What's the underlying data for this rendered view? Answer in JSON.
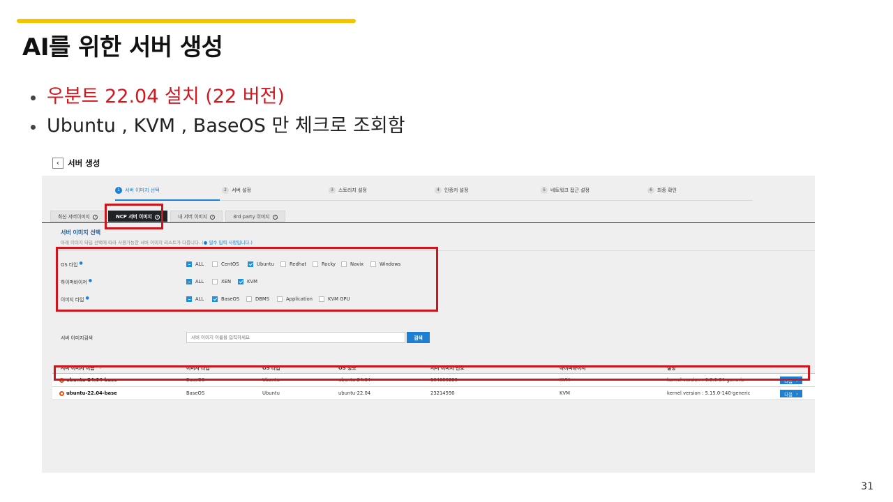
{
  "slide": {
    "title": "AI를 위한 서버 생성",
    "bullets": [
      "우분트 22.04 설치 (22 버전)",
      "Ubuntu , KVM , BaseOS 만 체크로 조회함"
    ],
    "page_number": "31",
    "accent_color": "#f6c300",
    "highlight_color": "#d4161e"
  },
  "console": {
    "title": "서버 생성",
    "back_icon": "chevron-left-icon",
    "steps": [
      {
        "num": "1",
        "label": "서버 이미지 선택",
        "active": true
      },
      {
        "num": "2",
        "label": "서버 설정"
      },
      {
        "num": "3",
        "label": "스토리지 설정"
      },
      {
        "num": "4",
        "label": "인증키 설정"
      },
      {
        "num": "5",
        "label": "네트워크 접근 설정"
      },
      {
        "num": "6",
        "label": "최종 확인"
      }
    ],
    "tabs": [
      {
        "label": "최신 서버이미지",
        "active": false
      },
      {
        "label": "NCP 서버 이미지",
        "active": true
      },
      {
        "label": "내 서버 이미지",
        "active": false
      },
      {
        "label": "3rd party 이미지",
        "active": false
      }
    ],
    "section_title": "서버 이미지 선택",
    "section_desc": "아래 이미지 타입 선택에 따라 사용가능한 서버 이미지 리스트가 다릅니다. (",
    "section_desc_req": "● 필수 입력 사항입니다.)",
    "filters": {
      "os": {
        "label": "OS 타입",
        "options": [
          "ALL",
          "CentOS",
          "Ubuntu",
          "Redhat",
          "Rocky",
          "Navix",
          "Windows"
        ],
        "checked": [
          false,
          false,
          true,
          false,
          false,
          false,
          false
        ]
      },
      "hypervisor": {
        "label": "하이퍼바이저",
        "options": [
          "ALL",
          "XEN",
          "KVM"
        ],
        "checked": [
          false,
          false,
          true
        ]
      },
      "image_type": {
        "label": "이미지 타입",
        "options": [
          "ALL",
          "BaseOS",
          "DBMS",
          "Application",
          "KVM GPU"
        ],
        "checked": [
          false,
          true,
          false,
          false,
          false
        ]
      }
    },
    "search": {
      "label": "서버 이미지검색",
      "placeholder": "서버 이미지 이름을 입력하세요",
      "button": "검색"
    },
    "table": {
      "columns": [
        "서버 이미지 이름",
        "이미지 타입",
        "OS 타입",
        "OS 정보",
        "서버 이미지 번호",
        "하이퍼바이저",
        "설명"
      ],
      "rows": [
        [
          "ubuntu-24.04-base",
          "BaseOS",
          "Ubuntu",
          "ubuntu-24.04",
          "104630229",
          "KVM",
          "kernel version : 6.8.0-84-generic"
        ],
        [
          "ubuntu-22.04-base",
          "BaseOS",
          "Ubuntu",
          "ubuntu-22.04",
          "23214590",
          "KVM",
          "kernel version : 5.15.0-140-generic"
        ]
      ],
      "next_label": "다음",
      "next_icon": "chevron-right-icon"
    }
  }
}
